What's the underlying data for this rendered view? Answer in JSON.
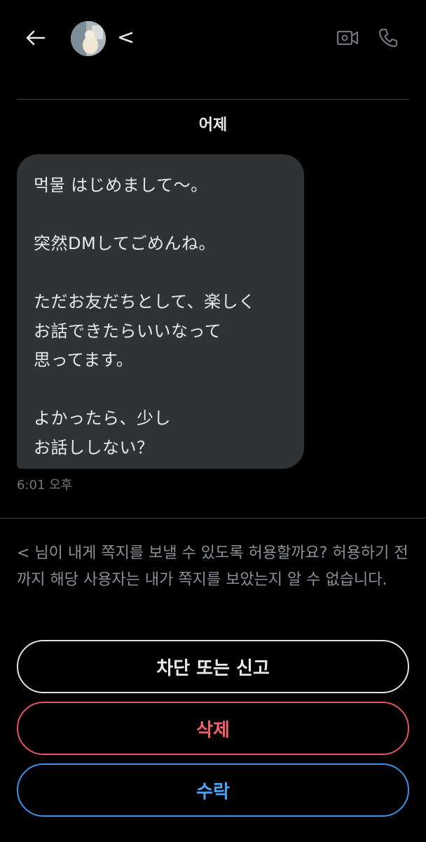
{
  "header": {
    "name": "<",
    "back_icon": "arrow-left-icon",
    "video_icon": "video-camera-icon",
    "call_icon": "phone-icon"
  },
  "conversation": {
    "date_separator": "어제",
    "message": {
      "text": "먹물 はじめまして〜。\n\n突然DMしてごめんね。\n\nただお友だちとして、楽しく\nお話できたらいいなって\n思ってます。\n\nよかったら、少し\nお話ししない？",
      "time": "6:01 오후"
    }
  },
  "request": {
    "prompt": "< 님이 내게 쪽지를 보낼 수 있도록 허용할까요? 허용하기 전까지 해당 사용자는 내가 쪽지를 보았는지 알 수 없습니다.",
    "block_label": "차단 또는 신고",
    "delete_label": "삭제",
    "accept_label": "수락"
  },
  "colors": {
    "background": "#000000",
    "bubble": "#2f3336",
    "delete": "#f0606a",
    "accept": "#4aa3f2"
  }
}
